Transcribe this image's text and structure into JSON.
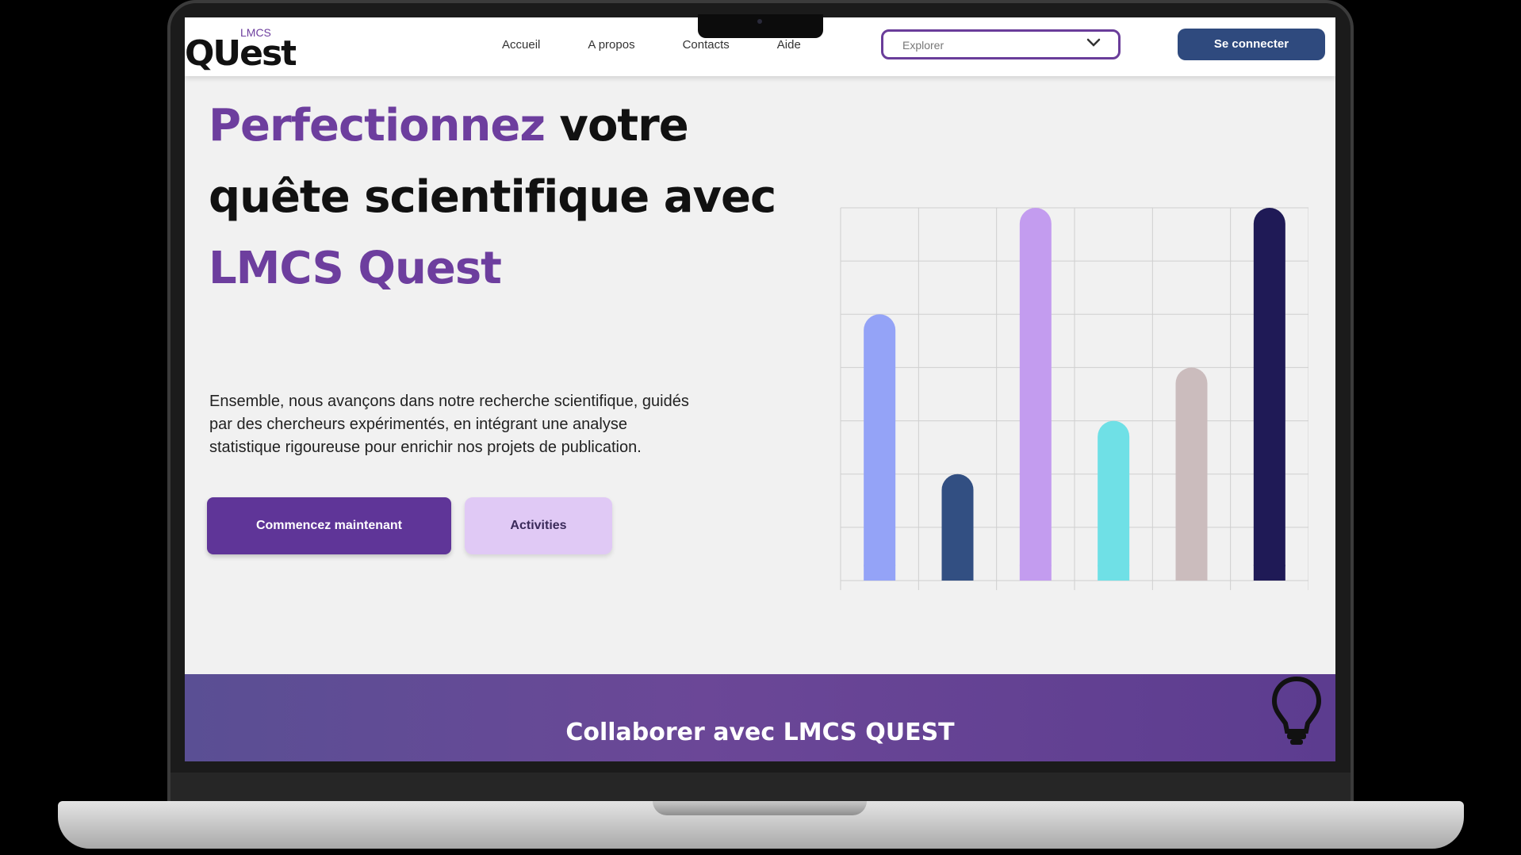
{
  "nav": {
    "logo_small": "LMCS",
    "logo_main": "QUest",
    "links": [
      "Accueil",
      "A propos",
      "Contacts",
      "Aide"
    ],
    "explore_placeholder": "Explorer",
    "login_label": "Se connecter"
  },
  "hero": {
    "line1_accent": "Perfectionnez",
    "line1_rest": " votre",
    "line2": "quête scientifique avec",
    "line3_accent": "LMCS Quest",
    "description": "Ensemble, nous avançons dans notre recherche scientifique, guidés par des chercheurs expérimentés, en intégrant une analyse statistique rigoureuse pour enrichir nos projets de publication.",
    "primary_button": "Commencez maintenant",
    "secondary_button": "Activities"
  },
  "chart_data": {
    "type": "bar",
    "categories": [
      "",
      "",
      "",
      "",
      "",
      ""
    ],
    "values": [
      5,
      2,
      7,
      3,
      4,
      7
    ],
    "ylim": [
      0,
      7
    ],
    "colors": [
      "#94a3f7",
      "#324f82",
      "#c39cef",
      "#6fe0e6",
      "#cbbcbd",
      "#1f1a56"
    ],
    "grid": true
  },
  "footer": {
    "title": "Collaborer avec LMCS QUEST"
  },
  "icons": {
    "dropdown": "chevron-down-icon",
    "footer": "lightbulb-icon"
  },
  "colors": {
    "accent": "#6d3e9e",
    "primary_button": "#5f3598",
    "login_button": "#2f4a7e",
    "secondary_button": "#e0c9f5"
  }
}
